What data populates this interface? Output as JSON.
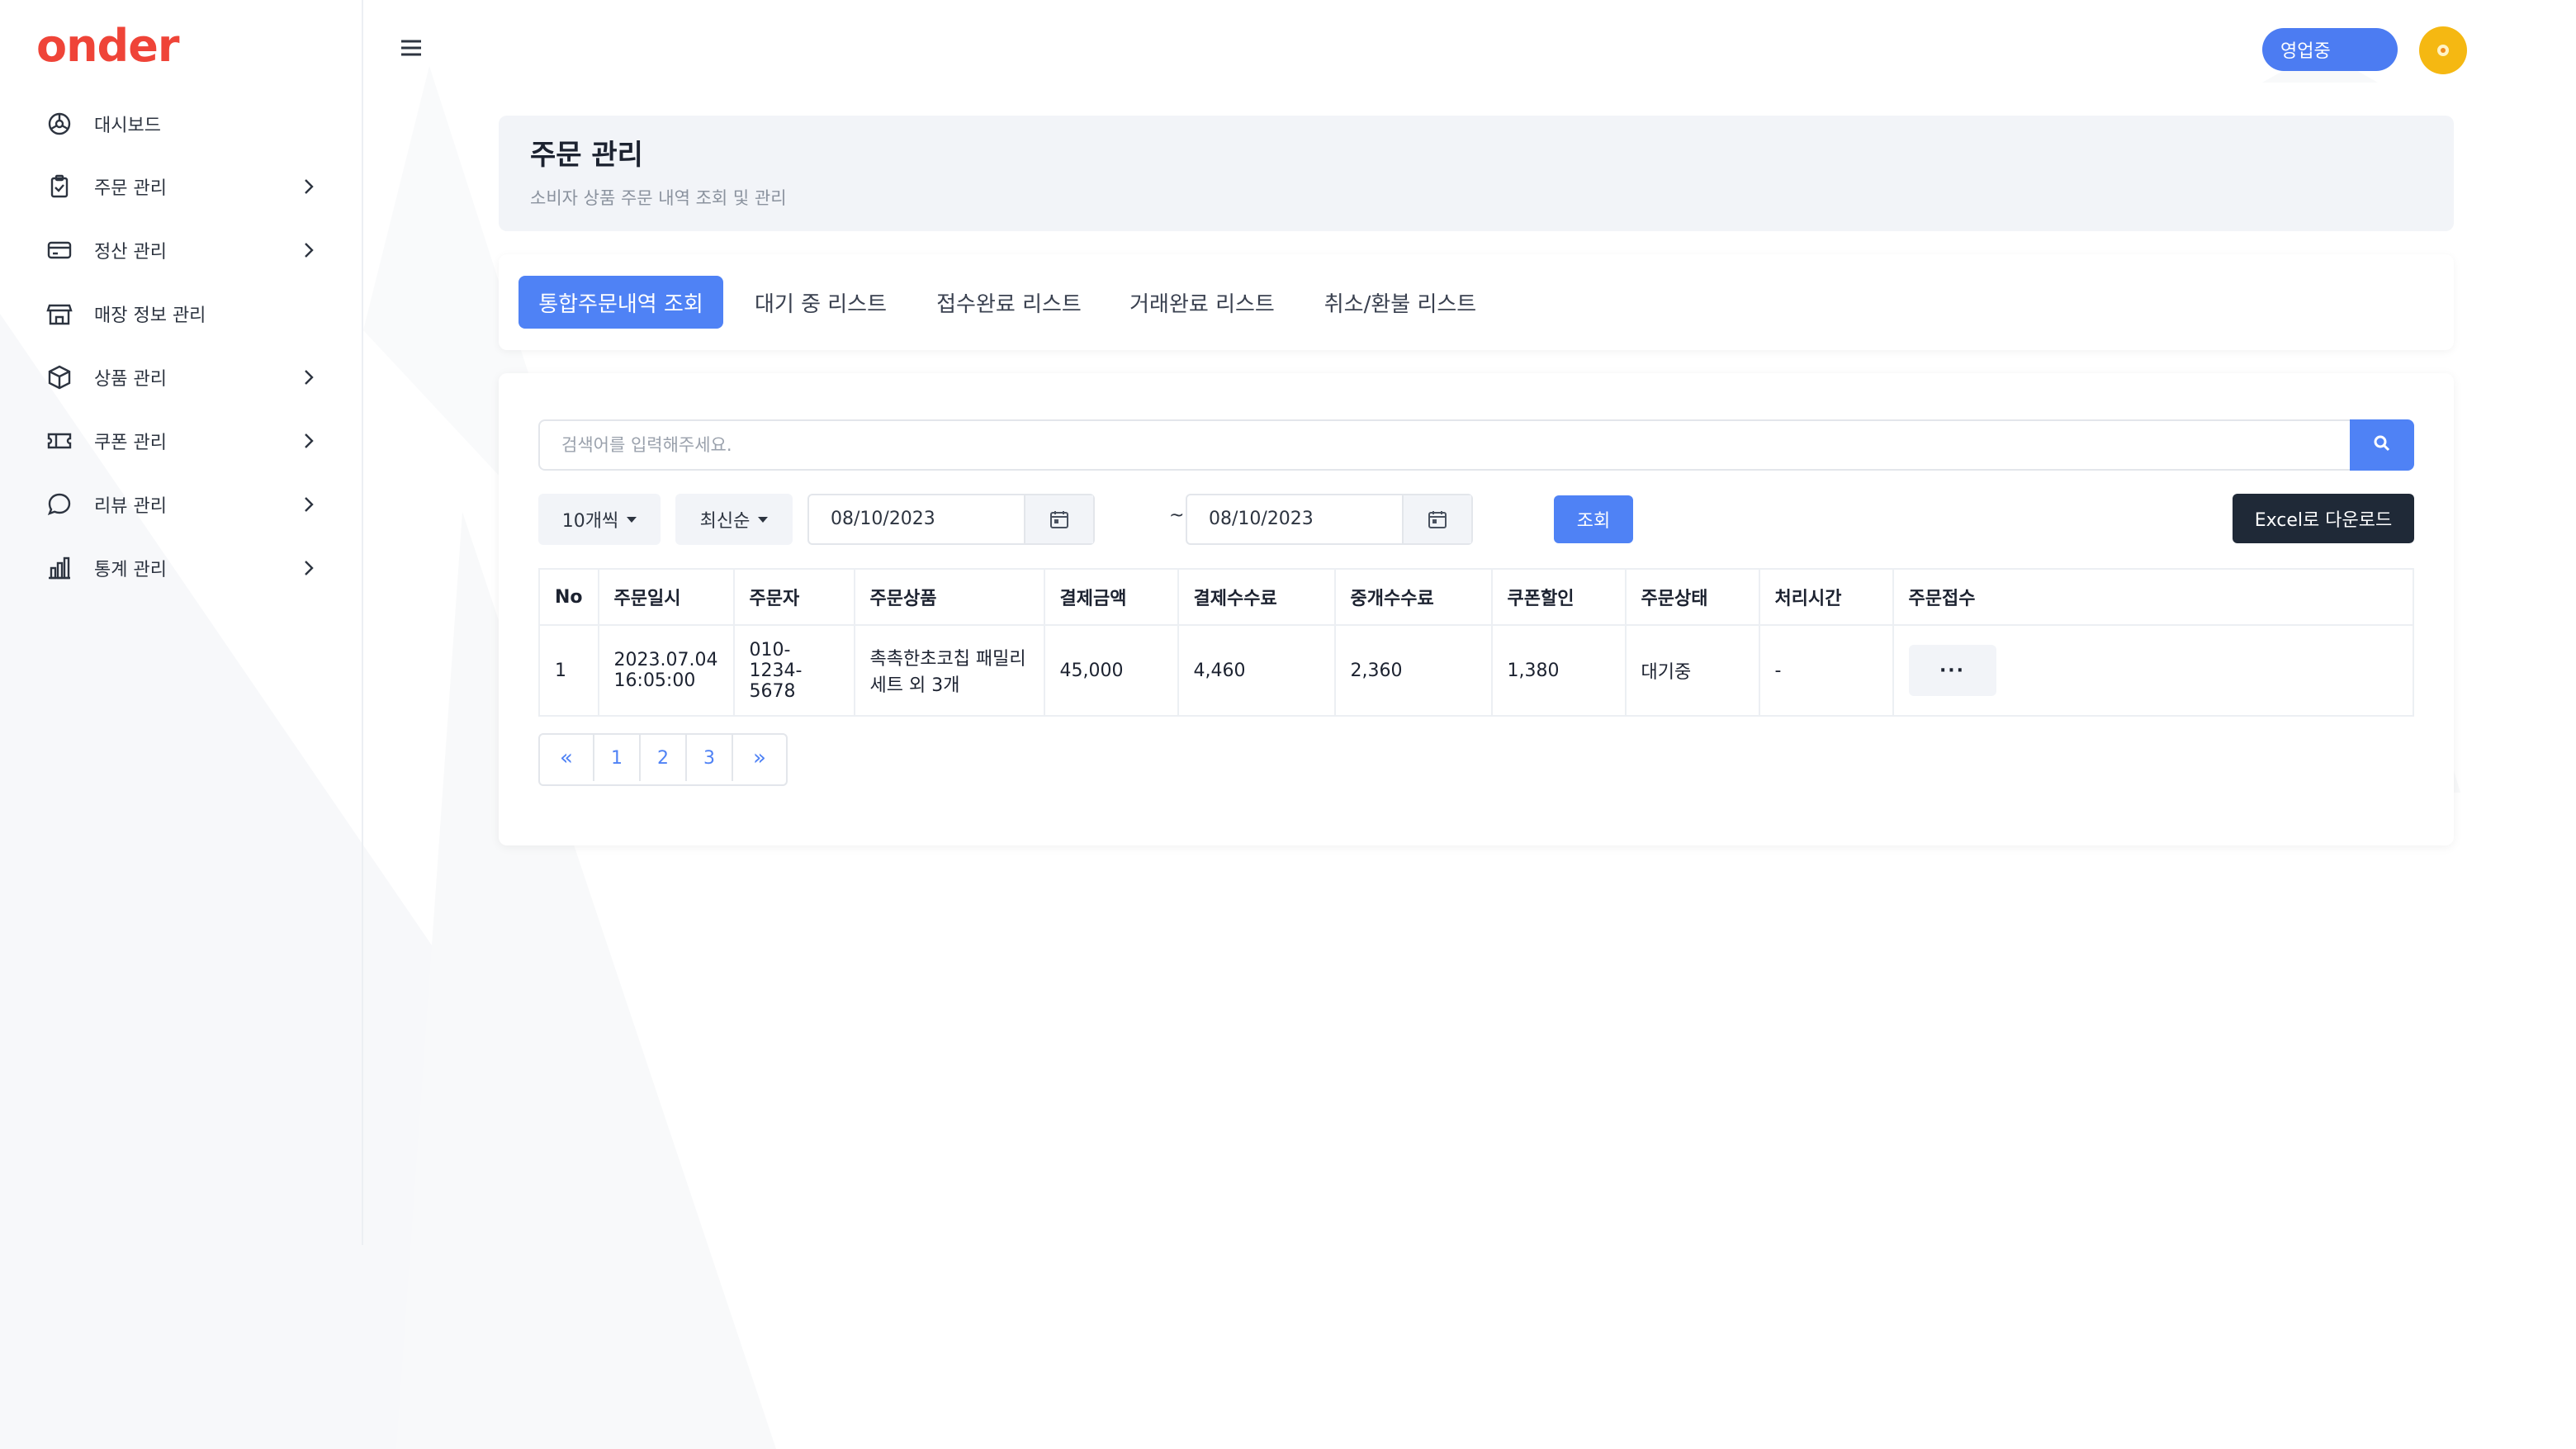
{
  "app": {
    "logo": "onder"
  },
  "sidebar": {
    "items": [
      {
        "label": "대시보드",
        "icon": "dashboard-icon",
        "has_children": false
      },
      {
        "label": "주문 관리",
        "icon": "clipboard-icon",
        "has_children": true
      },
      {
        "label": "정산 관리",
        "icon": "card-icon",
        "has_children": true
      },
      {
        "label": "매장 정보 관리",
        "icon": "store-icon",
        "has_children": false
      },
      {
        "label": "상품 관리",
        "icon": "box-icon",
        "has_children": true
      },
      {
        "label": "쿠폰 관리",
        "icon": "ticket-icon",
        "has_children": true
      },
      {
        "label": "리뷰 관리",
        "icon": "chat-icon",
        "has_children": true
      },
      {
        "label": "통계 관리",
        "icon": "chart-icon",
        "has_children": true
      }
    ]
  },
  "topbar": {
    "status_label": "영업중"
  },
  "header": {
    "title": "주문 관리",
    "subtitle": "소비자 상품 주문 내역 조회 및 관리"
  },
  "tabs": [
    {
      "label": "통합주문내역 조회",
      "active": true
    },
    {
      "label": "대기 중 리스트",
      "active": false
    },
    {
      "label": "접수완료 리스트",
      "active": false
    },
    {
      "label": "거래완료 리스트",
      "active": false
    },
    {
      "label": "취소/환불 리스트",
      "active": false
    }
  ],
  "filters": {
    "search_placeholder": "검색어를 입력해주세요.",
    "page_size": "10개씩",
    "sort": "최신순",
    "date_from": "08/10/2023",
    "date_sep": "~",
    "date_to": "08/10/2023",
    "query_label": "조회",
    "excel_label": "Excel로 다운로드"
  },
  "table": {
    "columns": [
      "No",
      "주문일시",
      "주문자",
      "주문상품",
      "결제금액",
      "결제수수료",
      "중개수수료",
      "쿠폰할인",
      "주문상태",
      "처리시간",
      "주문접수"
    ],
    "rows": [
      {
        "no": "1",
        "date": "2023.07.04",
        "time": "16:05:00",
        "customer": "010-1234-5678",
        "product": "촉촉한초코칩 패밀리세트 외 3개",
        "amount": "45,000",
        "payment_fee": "4,460",
        "broker_fee": "2,360",
        "coupon": "1,380",
        "status": "대기중",
        "processing_time": "-",
        "action": "···"
      }
    ]
  },
  "pagination": {
    "prev": "«",
    "pages": [
      "1",
      "2",
      "3"
    ],
    "next": "»"
  },
  "colors": {
    "primary": "#4f82f5",
    "brand": "#ef4438",
    "dark": "#1f2937",
    "avatar": "#f5b812"
  }
}
